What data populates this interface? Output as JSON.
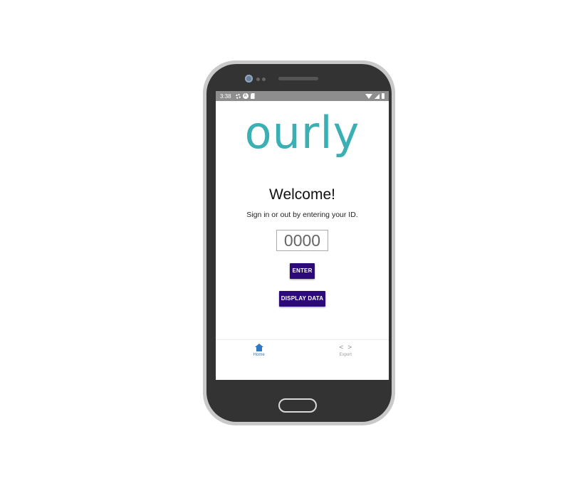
{
  "status_bar": {
    "time": "3:38",
    "a_badge": "A"
  },
  "app": {
    "logo_text": "ourly",
    "welcome_title": "Welcome!",
    "instruction": "Sign in or out by entering your ID.",
    "id_input": {
      "value": "",
      "placeholder": "0000"
    },
    "enter_button": "ENTER",
    "display_data_button": "DISPLAY DATA"
  },
  "tab_bar": {
    "tabs": [
      {
        "label": "Home",
        "icon": "home-icon",
        "active": true
      },
      {
        "label": "Export",
        "icon": "code-icon",
        "active": false
      }
    ]
  },
  "colors": {
    "logo": "#3bb0b4",
    "button": "#2c0a7a",
    "active_tab": "#2f78c4",
    "inactive_tab": "#9a9a9a",
    "status_bar": "#8e8e8e",
    "phone_body": "#333333"
  }
}
